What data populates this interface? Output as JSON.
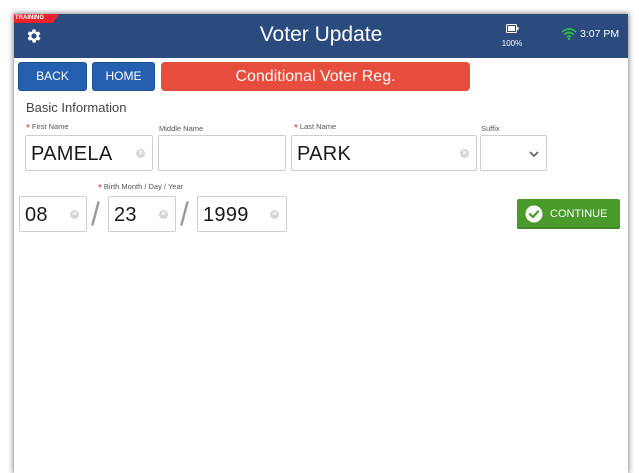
{
  "header": {
    "training_badge": "TRAINING",
    "title": "Voter Update",
    "battery_percent": "100%",
    "time": "3:07 PM",
    "icons": [
      "gear-icon",
      "battery-icon",
      "wifi-icon"
    ]
  },
  "nav": {
    "back_label": "BACK",
    "home_label": "HOME",
    "banner_label": "Conditional Voter Reg."
  },
  "form": {
    "section_title": "Basic Information",
    "required_marker": "*",
    "first_name": {
      "label": "First Name",
      "value": "PAMELA"
    },
    "middle_name": {
      "label": "Middle Name",
      "value": ""
    },
    "last_name": {
      "label": "Last Name",
      "value": "PARK"
    },
    "suffix": {
      "label": "Suffix",
      "value": ""
    },
    "birth": {
      "label": "Birth Month / Day / Year",
      "month": "08",
      "day": "23",
      "year": "1999",
      "separator": "/"
    },
    "continue_label": "CONTINUE"
  },
  "colors": {
    "header_bg": "#2b4a7d",
    "nav_button": "#2560b0",
    "banner": "#e64d3d",
    "continue": "#4a9a2c",
    "training": "#e8232d",
    "required": "#e3262b"
  }
}
